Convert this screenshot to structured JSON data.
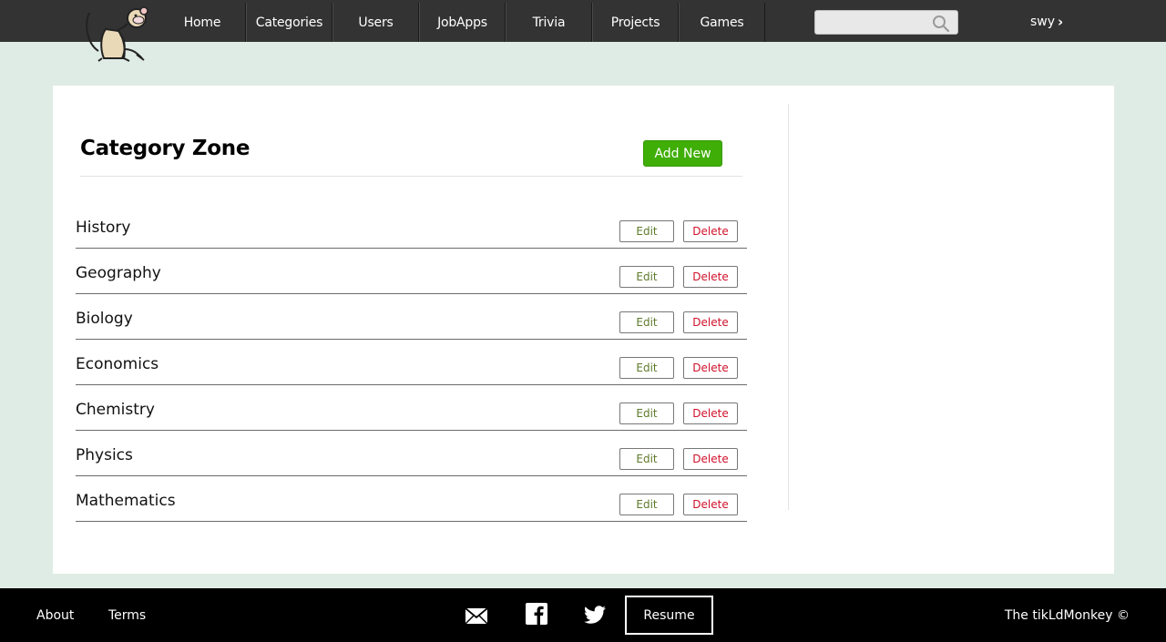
{
  "nav": {
    "items": [
      {
        "label": "Home"
      },
      {
        "label": "Categories"
      },
      {
        "label": "Users"
      },
      {
        "label": "JobApps"
      },
      {
        "label": "Trivia"
      },
      {
        "label": "Projects"
      },
      {
        "label": "Games"
      }
    ],
    "search": {
      "placeholder": "",
      "value": ""
    },
    "user": {
      "label": "swy",
      "icon": "chevron-right-icon"
    }
  },
  "main": {
    "title": "Category Zone",
    "add_label": "Add New",
    "edit_label": "Edit",
    "delete_label": "Delete",
    "categories": [
      {
        "name": "History"
      },
      {
        "name": "Geography"
      },
      {
        "name": "Biology"
      },
      {
        "name": "Economics"
      },
      {
        "name": "Chemistry"
      },
      {
        "name": "Physics"
      },
      {
        "name": "Mathematics"
      }
    ]
  },
  "footer": {
    "about": "About",
    "terms": "Terms",
    "resume": "Resume",
    "copyright": "The tikLdMonkey ©",
    "icons": [
      "mail-icon",
      "facebook-icon",
      "twitter-icon"
    ]
  },
  "colors": {
    "topbar": "#333333",
    "page_bg": "#dfece5",
    "add_button": "#3fae06",
    "delete_text": "#d0112b",
    "edit_text": "#5e7a2a"
  }
}
